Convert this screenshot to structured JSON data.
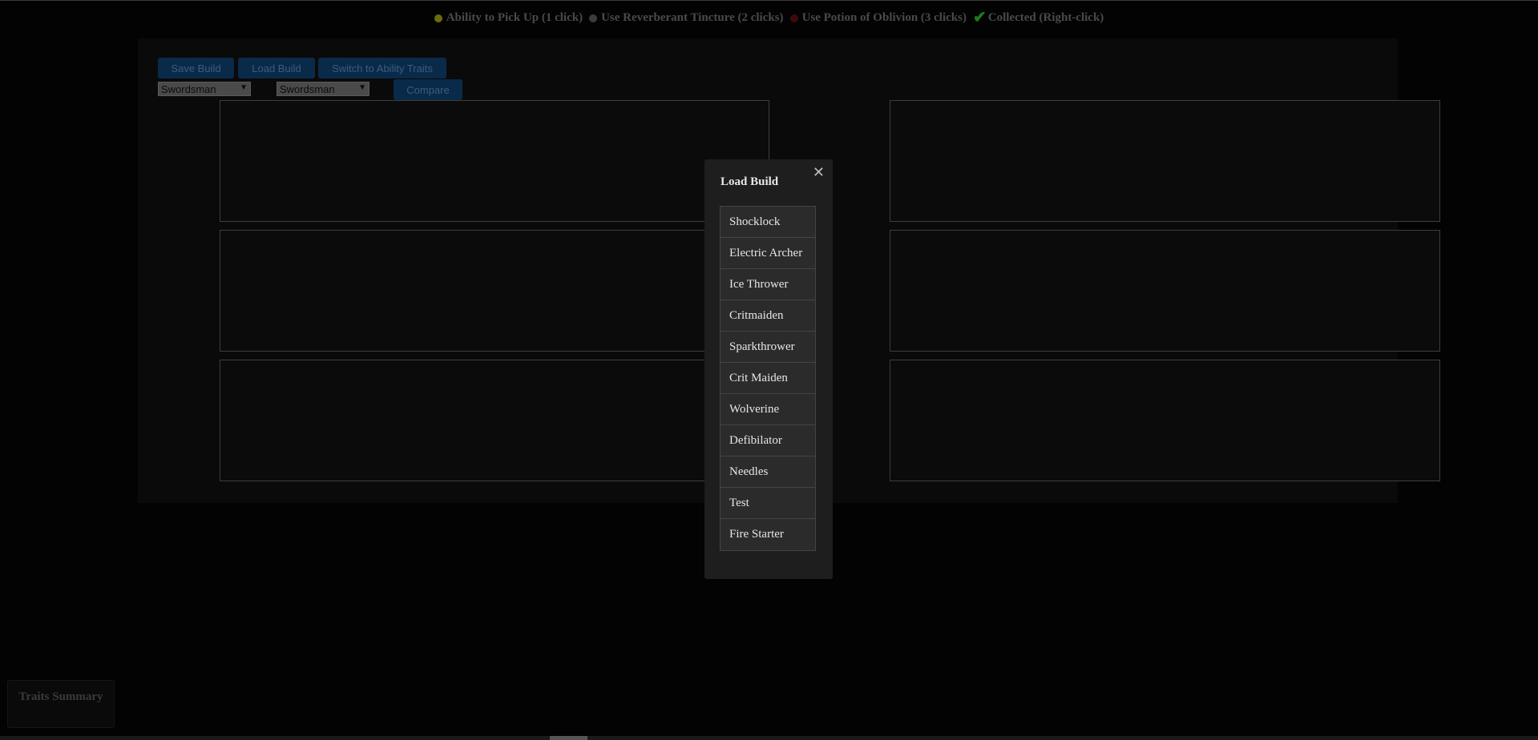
{
  "legend": {
    "items": [
      {
        "label": "Ability to Pick Up (1 click)",
        "icon": "yellow-dot-icon"
      },
      {
        "label": "Use Reverberant Tincture (2 clicks)",
        "icon": "gray-dot-icon"
      },
      {
        "label": "Use Potion of Oblivion (3 clicks)",
        "icon": "red-dot-icon"
      },
      {
        "label": "Collected (Right-click)",
        "icon": "checkmark-icon"
      }
    ]
  },
  "toolbar": {
    "save_label": "Save Build",
    "load_label": "Load Build",
    "switch_label": "Switch to Ability Traits",
    "compare_label": "Compare",
    "select_left": "Swordsman",
    "select_right": "Swordsman"
  },
  "modal": {
    "title": "Load Build",
    "close": "✕",
    "builds": [
      "Shocklock",
      "Electric Archer",
      "Ice Thrower",
      "Critmaiden",
      "Sparkthrower",
      "Crit Maiden",
      "Wolverine",
      "Defibilator",
      "Needles",
      "Test",
      "Fire Starter"
    ]
  },
  "traits_summary": {
    "label": "Traits Summary"
  },
  "colors": {
    "accent": "#0a2a4a",
    "pick_up": "#6b6b10",
    "tincture": "#3c3c3c",
    "oblivion": "#3d0a0a",
    "collected": "#1d7a1d"
  }
}
